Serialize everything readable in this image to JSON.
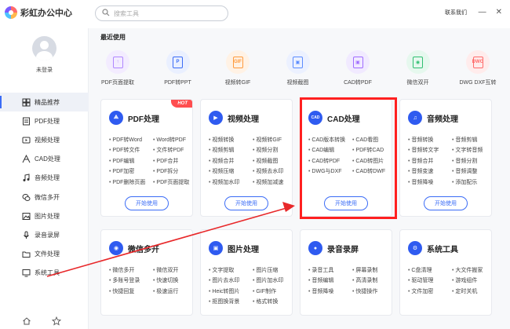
{
  "app": {
    "title": "彩虹办公中心"
  },
  "search": {
    "placeholder": "搜索工具"
  },
  "header": {
    "contact": "联系我们",
    "minimize_glyph": "—",
    "close_glyph": "✕"
  },
  "user": {
    "login_label": "未登录"
  },
  "sidebar": {
    "items": [
      {
        "label": "精品推荐",
        "icon": "grid-icon",
        "active": true
      },
      {
        "label": "PDF处理",
        "icon": "pdf-icon"
      },
      {
        "label": "视频处理",
        "icon": "video-icon"
      },
      {
        "label": "CAD处理",
        "icon": "cad-icon"
      },
      {
        "label": "音频处理",
        "icon": "music-icon"
      },
      {
        "label": "微信多开",
        "icon": "wechat-icon"
      },
      {
        "label": "图片处理",
        "icon": "image-icon"
      },
      {
        "label": "录音录屏",
        "icon": "mic-icon"
      },
      {
        "label": "文件处理",
        "icon": "folder-icon"
      },
      {
        "label": "系统工具",
        "icon": "system-icon"
      }
    ]
  },
  "recent": {
    "title": "最近使用",
    "items": [
      {
        "label": "PDF页面提取",
        "color": "#b086ff",
        "bg": "#f3ecff",
        "glyph": "↑"
      },
      {
        "label": "PDF转PPT",
        "color": "#3b6cf6",
        "bg": "#eaf0ff",
        "glyph": "P"
      },
      {
        "label": "视频转GIF",
        "color": "#ff9a3c",
        "bg": "#fff2e5",
        "glyph": "GIF"
      },
      {
        "label": "视频截图",
        "color": "#5b8cff",
        "bg": "#ecf1ff",
        "glyph": "▣"
      },
      {
        "label": "CAD转PDF",
        "color": "#a06cff",
        "bg": "#f1eaff",
        "glyph": "▣"
      },
      {
        "label": "微信双开",
        "color": "#2fbf71",
        "bg": "#e6f8ee",
        "glyph": "◉"
      },
      {
        "label": "DWG DXF互转",
        "color": "#ff6b6b",
        "bg": "#ffecec",
        "glyph": "DWG"
      }
    ]
  },
  "cards": [
    {
      "title": "PDF处理",
      "icon": "pdf-icon",
      "icon_glyph": "⟁",
      "hot": "HOT",
      "features": [
        "PDF转Word",
        "Word转PDF",
        "PDF转文件",
        "文件转PDF",
        "PDF编辑",
        "PDF合并",
        "PDF加密",
        "PDF拆分",
        "PDF删除页面",
        "PDF页面提取"
      ],
      "button": "开始使用"
    },
    {
      "title": "视频处理",
      "icon": "video-icon",
      "icon_glyph": "▶",
      "features": [
        "视频转换",
        "视频转GIF",
        "视频剪辑",
        "视频分割",
        "视频合并",
        "视频截图",
        "视频压缩",
        "视频去水印",
        "视频加水印",
        "视频加减速"
      ],
      "button": "开始使用"
    },
    {
      "title": "CAD处理",
      "icon": "cad-icon",
      "icon_glyph": "CAD",
      "features": [
        "CAD版本转换",
        "CAD看图",
        "CAD编辑",
        "PDF转CAD",
        "CAD转PDF",
        "CAD转图片",
        "DWG与DXF",
        "CAD转DWF"
      ],
      "button": "开始使用"
    },
    {
      "title": "音频处理",
      "icon": "music-icon",
      "icon_glyph": "♫",
      "features": [
        "音频转换",
        "音频剪辑",
        "音频转文字",
        "文字转音频",
        "音频合并",
        "音频分割",
        "音频变速",
        "音频调整",
        "音频降噪",
        "添加配乐"
      ],
      "button": "开始使用"
    },
    {
      "title": "微信多开",
      "icon": "wechat-icon",
      "icon_glyph": "◉",
      "features": [
        "微信多开",
        "微信双开",
        "多账号登录",
        "快速切换",
        "快捷回复",
        "极速运行"
      ]
    },
    {
      "title": "图片处理",
      "icon": "image-icon",
      "icon_glyph": "▣",
      "features": [
        "文字提取",
        "图片压缩",
        "图片去水印",
        "图片加水印",
        "Heic转图片",
        "GIF制作",
        "抠图换背景",
        "格式转换"
      ]
    },
    {
      "title": "录音录屏",
      "icon": "mic-icon",
      "icon_glyph": "●",
      "features": [
        "录音工具",
        "屏幕录制",
        "音频编辑",
        "高清录制",
        "音频降噪",
        "快捷操作"
      ]
    },
    {
      "title": "系统工具",
      "icon": "system-icon",
      "icon_glyph": "⚙",
      "features": [
        "C盘清理",
        "大文件搬家",
        "驱动管理",
        "游戏组件",
        "文件加密",
        "定时关机"
      ]
    }
  ],
  "colors": {
    "accent": "#3b6cf6",
    "highlight": "#ff2020",
    "hot": "#ff4d4f"
  }
}
